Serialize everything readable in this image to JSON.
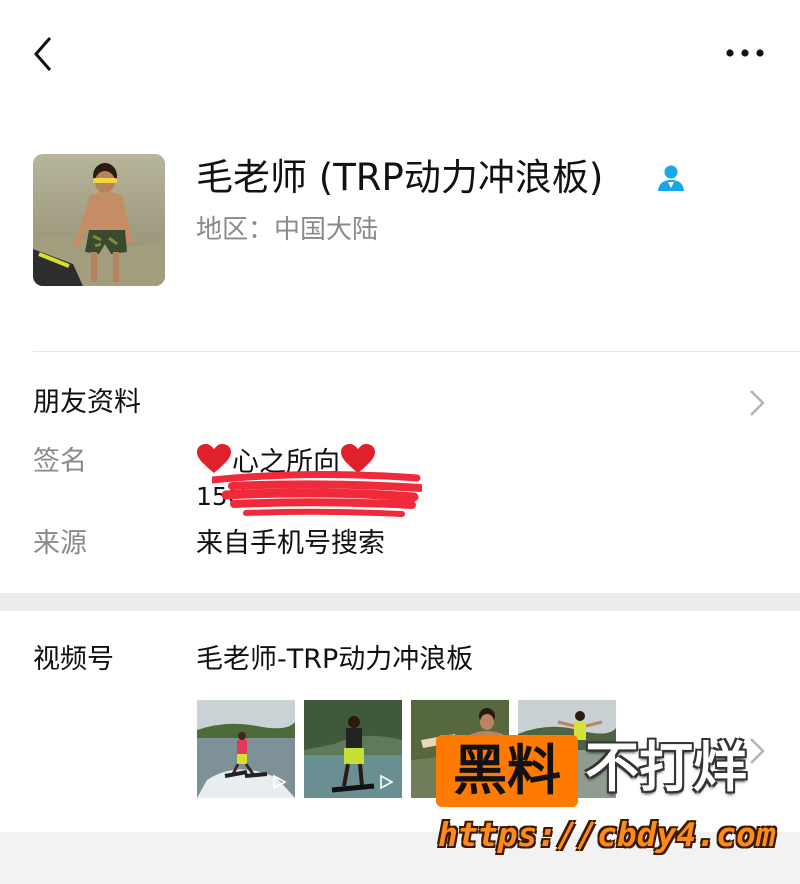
{
  "topbar": {
    "back_icon": "chevron-left-icon",
    "more_icon": "more-dots-icon"
  },
  "profile": {
    "name": "毛老师 (TRP动力冲浪板)",
    "verify_icon": "contact-person-icon",
    "verify_color": "#1aa7e8",
    "region": "地区：中国大陆"
  },
  "friend_info": {
    "title": "朋友资料",
    "signature_label": "签名",
    "signature_value": "心之所向",
    "phone_partial": "15C",
    "source_label": "来源",
    "source_value": "来自手机号搜索"
  },
  "channels": {
    "label": "视频号",
    "value": "毛老师-TRP动力冲浪板",
    "thumbnail_count": 4
  },
  "watermark": {
    "box_text": "黑料",
    "side_text": "不打烊",
    "url": "https://cbdy4.com",
    "accent": "#ff7a00"
  },
  "colors": {
    "heart": "#e0202a",
    "redact": "#ef2a3a",
    "secondary_text": "#8a8a8a",
    "divider": "#ededed"
  }
}
